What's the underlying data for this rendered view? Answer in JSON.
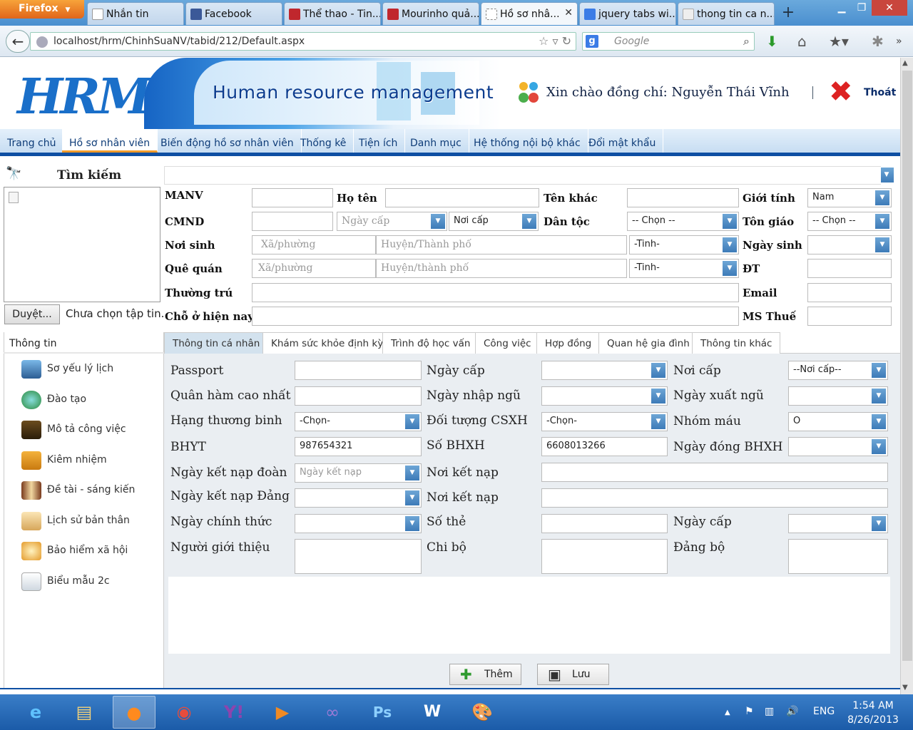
{
  "browser": {
    "firefox_label": "Firefox",
    "tabs": [
      {
        "label": "Nhắn tin",
        "icon": "page-icon"
      },
      {
        "label": "Facebook",
        "icon": "facebook-icon"
      },
      {
        "label": "Thể thao - Tin...",
        "icon": "e-news-icon"
      },
      {
        "label": "Mourinho quả...",
        "icon": "e-news-icon"
      },
      {
        "label": "Hồ sơ nhâ...",
        "icon": "blank-page-icon",
        "active": true
      },
      {
        "label": "jquery tabs wi...",
        "icon": "google-icon"
      },
      {
        "label": "thong tin ca n...",
        "icon": "page-icon"
      }
    ],
    "url": "localhost/hrm/ChinhSuaNV/tabid/212/Default.aspx",
    "search_placeholder": "Google"
  },
  "header": {
    "logo_text": "HRM",
    "banner_text": "Human resource management",
    "welcome": "Xin chào đồng chí: Nguyễn Thái Vĩnh",
    "logout": "Thoát"
  },
  "menu": [
    "Trang chủ",
    "Hồ sơ nhân viên",
    "Biến động hồ sơ nhân viên",
    "Thống kê",
    "Tiện ích",
    "Danh mục",
    "Hệ thống nội bộ khác",
    "Đổi mật khẩu"
  ],
  "search": {
    "title": "Tìm kiếm",
    "browse": "Duyệt...",
    "no_file": "Chưa chọn tập tin."
  },
  "top_form": {
    "manv": "MANV",
    "hoten": "Họ tên",
    "tenkhac": "Tên khác",
    "gioitinh": "Giới tính",
    "gioitinh_value": "Nam",
    "cmnd": "CMND",
    "ngaycap_ph": "Ngày cấp",
    "noicap_value": "Nơi cấp",
    "dantoc": "Dân tộc",
    "dantoc_value": "-- Chọn --",
    "tongiao": "Tôn giáo",
    "tongiao_value": "-- Chọn --",
    "noisinh": "Nơi sinh",
    "xa_ph": "Xã/phường",
    "huyen_ph": "Huyện/Thành phố",
    "tinh_value": "-Tinh-",
    "ngaysinh": "Ngày sinh",
    "quequan": "Quê quán",
    "xa2_ph": "Xã/phường",
    "huyen2_ph": "Huyện/thành phố",
    "tinh2_value": "-Tinh-",
    "dt": "ĐT",
    "thuongtru": "Thường trú",
    "email": "Email",
    "chohiennay": "Chỗ ở hiện nay",
    "msthue": "MS Thuế"
  },
  "side_panel": {
    "header": "Thông tin",
    "items": [
      {
        "label": "Sơ yếu lý lịch",
        "icon": "monitor-icon"
      },
      {
        "label": "Đào tạo",
        "icon": "globe-icon"
      },
      {
        "label": "Mô tả công việc",
        "icon": "box-icon"
      },
      {
        "label": "Kiêm nhiệm",
        "icon": "book-icon"
      },
      {
        "label": "Đề tài - sáng kiến",
        "icon": "books-icon"
      },
      {
        "label": "Lịch sử bản thân",
        "icon": "notebook-icon"
      },
      {
        "label": "Bảo hiểm xã hội",
        "icon": "palette-icon"
      },
      {
        "label": "Biểu mẫu 2c",
        "icon": "mail-add-icon"
      }
    ]
  },
  "inner_tabs": [
    "Thông tin cá nhân",
    "Khám sức khỏe định kỳ",
    "Trình độ học vấn",
    "Công việc",
    "Hợp đồng",
    "Quan hệ gia đình",
    "Thông tin khác"
  ],
  "personal_form": {
    "passport": "Passport",
    "ngaycap": "Ngày cấp",
    "noicap": "Nơi cấp",
    "noicap_value": "--Nơi cấp--",
    "quanham": "Quân hàm cao nhất",
    "ngaynhapngu": "Ngày nhập ngũ",
    "ngayxuatngu": "Ngày xuất ngũ",
    "hangthuongbinh": "Hạng thương binh",
    "hangthuongbinh_value": "-Chọn-",
    "doituongcsxh": "Đối tượng CSXH",
    "doituongcsxh_value": "-Chọn-",
    "nhommau": "Nhóm máu",
    "nhommau_value": "O",
    "bhyt": "BHYT",
    "bhyt_value": "987654321",
    "sobhxh": "Số BHXH",
    "sobhxh_value": "6608013266",
    "ngaydongbhxh": "Ngày đóng BHXH",
    "ngayketnapdoan": "Ngày kết nạp đoàn",
    "ngayketnapdoan_ph": "Ngày kết nạp",
    "noiketnap1": "Nơi kết nạp",
    "ngayketnapdang": "Ngày kết nạp Đảng",
    "noiketnap2": "Nơi kết nạp",
    "ngaychinhthuc": "Ngày chính thức",
    "sothe": "Số thẻ",
    "ngaycap2": "Ngày cấp",
    "nguoigioithieu": "Người giới thiệu",
    "chibo": "Chi bộ",
    "dangbo": "Đảng bộ"
  },
  "buttons": {
    "add": "Thêm",
    "save": "Lưu"
  },
  "taskbar": {
    "apps": [
      "ie-icon",
      "explorer-icon",
      "firefox-icon",
      "chrome-icon",
      "yahoo-messenger-icon",
      "media-player-icon",
      "visual-studio-icon",
      "photoshop-icon",
      "word-icon",
      "paint-icon"
    ],
    "lang": "ENG",
    "time": "1:54 AM",
    "date": "8/26/2013"
  }
}
